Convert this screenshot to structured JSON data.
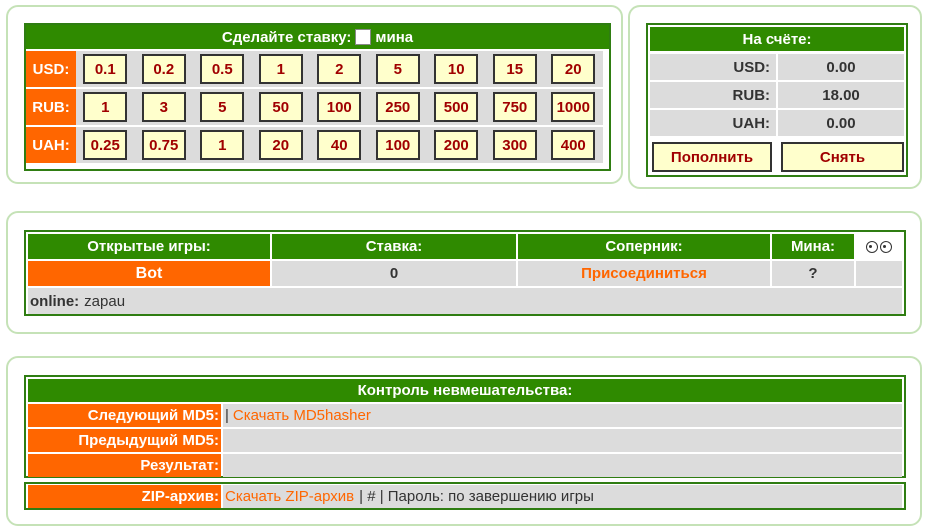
{
  "bet_panel": {
    "title": "Сделайте ставку:",
    "mine_label": "мина",
    "rows": [
      {
        "currency": "USD:",
        "values": [
          "0.1",
          "0.2",
          "0.5",
          "1",
          "2",
          "5",
          "10",
          "15",
          "20"
        ]
      },
      {
        "currency": "RUB:",
        "values": [
          "1",
          "3",
          "5",
          "50",
          "100",
          "250",
          "500",
          "750",
          "1000"
        ]
      },
      {
        "currency": "UAH:",
        "values": [
          "0.25",
          "0.75",
          "1",
          "20",
          "40",
          "100",
          "200",
          "300",
          "400"
        ]
      }
    ]
  },
  "balance_panel": {
    "title": "На счёте:",
    "rows": [
      {
        "currency": "USD:",
        "amount": "0.00"
      },
      {
        "currency": "RUB:",
        "amount": "18.00"
      },
      {
        "currency": "UAH:",
        "amount": "0.00"
      }
    ],
    "deposit_label": "Пополнить",
    "withdraw_label": "Снять"
  },
  "games_panel": {
    "headers": {
      "open_games": "Открытые игры:",
      "bet": "Ставка:",
      "opponent": "Соперник:",
      "mine": "Мина:",
      "eyes": "👀"
    },
    "row": {
      "player": "Bot",
      "bet": "0",
      "join": "Присоединиться",
      "mine": "?"
    },
    "online_label": "online:",
    "online_users": "zapau"
  },
  "control_panel": {
    "title": "Контроль невмешательства:",
    "next_md5_label": "Следующий MD5:",
    "next_md5_sep": "|",
    "next_md5_link": "Скачать MD5hasher",
    "prev_md5_label": "Предыдущий MD5:",
    "result_label": "Результат:",
    "zip_label": "ZIP-архив:",
    "zip_link": "Скачать ZIP-архив",
    "zip_tail": "| # | Пароль: по завершению игры"
  }
}
